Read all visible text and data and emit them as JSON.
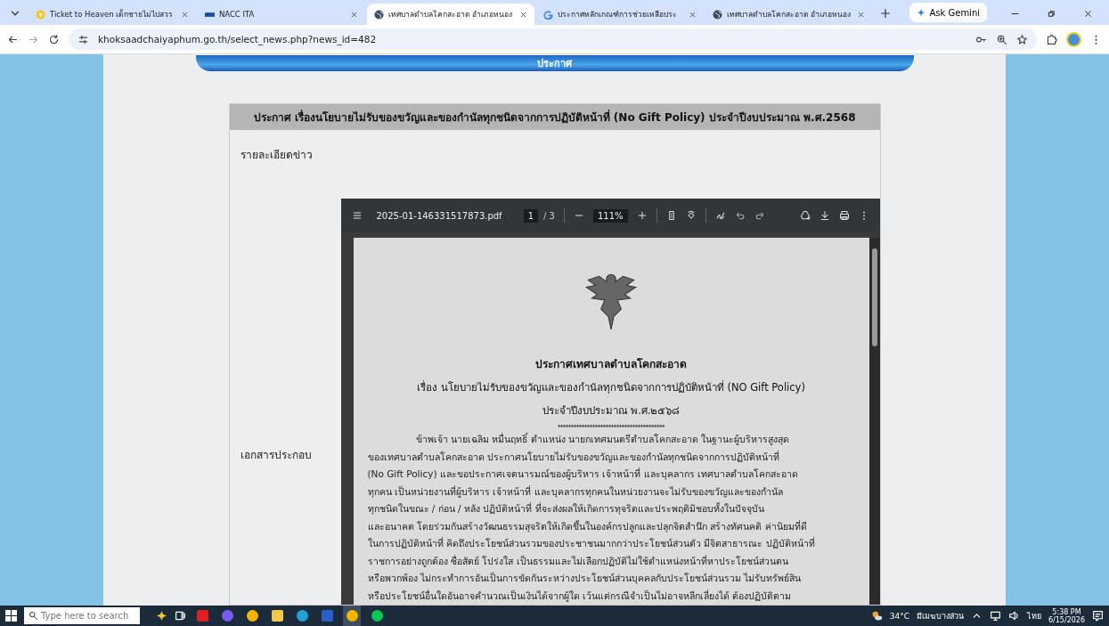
{
  "browser": {
    "tabs": [
      {
        "title": "Ticket to Heaven เด็กชายไม่ไปสวร",
        "selected": false
      },
      {
        "title": "NACC ITA",
        "selected": false
      },
      {
        "title": "เทศบาลตำบลโคกสะอาด อำเภอหนอง",
        "selected": true
      },
      {
        "title": "ประกาศหลักเกณฑ์การช่วยเหลือประ",
        "selected": false
      },
      {
        "title": "เทศบาลตำบลโคกสะอาด อำเภอหนอง",
        "selected": false
      }
    ],
    "ask_button": "Ask Gemini",
    "url": "khoksaadchaiyaphum.go.th/select_news.php?news_id=482"
  },
  "page": {
    "banner": "ประกาศ",
    "heading": "ประกาศ เรื่องนโยบายไม่รับของขวัญและของกำนัลทุกชนิดจากการปฏิบัติหน้าที่ (No Gift Policy) ประจำปีงบประมาณ พ.ศ.2568",
    "detail_label": "รายละเอียดข่าว",
    "attachment_label": "เอกสารประกอบ",
    "pdf": {
      "filename": "2025-01-146331517873.pdf",
      "page": "1",
      "pages": "/ 3",
      "zoom": "111%",
      "title": "ประกาศเทศบาลตำบลโคกสะอาด",
      "subject": "เรื่อง นโยบายไม่รับของขวัญและของกำนัลทุกชนิดจากการปฏิบัติหน้าที่ (NO Gift Policy)",
      "year": "ประจำปีงบประมาณ พ.ศ.๒๕๖๘",
      "separator": "****************************************",
      "body": [
        "ข้าพเจ้า นายเฉลิม หมื่นฤทธิ์ ตำแหน่ง นายกเทศมนตรีตำบลโคกสะอาด ในฐานะผู้บริหารสูงสุด",
        "ของเทศบาลตำบลโคกสะอาด ประกาศนโยบายไม่รับของขวัญและของกำนัลทุกชนิดจากการปฏิบัติหน้าที่",
        "(No Gift Policy) และขอประกาศเจตนารมณ์ของผู้บริหาร เจ้าหน้าที่ และบุคลากร เทศบาลตำบลโคกสะอาด",
        "ทุกคน เป็นหน่วยงานที่ผู้บริหาร เจ้าหน้าที่ และบุคลากรทุกคนในหน่วยงานจะไม่รับของขวัญและของกำนัล",
        "ทุกชนิดในขณะ / ก่อน / หลัง ปฏิบัติหน้าที่ ที่จะส่งผลให้เกิดการทุจริตและประพฤติมิชอบทั้งในปัจจุบัน",
        "และอนาคต โดยร่วมกันสร้างวัฒนธรรมสุจริตให้เกิดขึ้นในองค์กรปลูกและปลุกจิตสำนึก สร้างทัศนคติ ค่านิยมที่ดี",
        "ในการปฏิบัติหน้าที่ คิดถึงประโยชน์ส่วนรวมของประชาชนมากกว่าประโยชน์ส่วนตัว มีจิตสาธารณะ ปฏิบัติหน้าที่",
        "ราชการอย่างถูกต้อง ซื่อสัตย์ โปร่งใส เป็นธรรมและไม่เลือกปฏิบัติไม่ใช้ตำแหน่งหน้าที่หาประโยชน์ส่วนตน",
        "หรือพวกพ้อง ไม่กระทำการอันเป็นการขัดกันระหว่างประโยชน์ส่วนบุคคลกับประโยชน์ส่วนรวม ไม่รับทรัพย์สิน",
        "หรือประโยชน์อื่นใดอันอาจคำนวณเป็นเงินได้จากผู้ใด เว้นแต่กรณีจำเป็นไม่อาจหลีกเลี่ยงได้ ต้องปฏิบัติตาม"
      ]
    }
  },
  "taskbar": {
    "search_placeholder": "Type here to search",
    "weather": "34°C",
    "weather_text": "มีเมฆบางส่วน",
    "language": "ไทย",
    "time": "5:38 PM",
    "date": "6/15/2026"
  }
}
